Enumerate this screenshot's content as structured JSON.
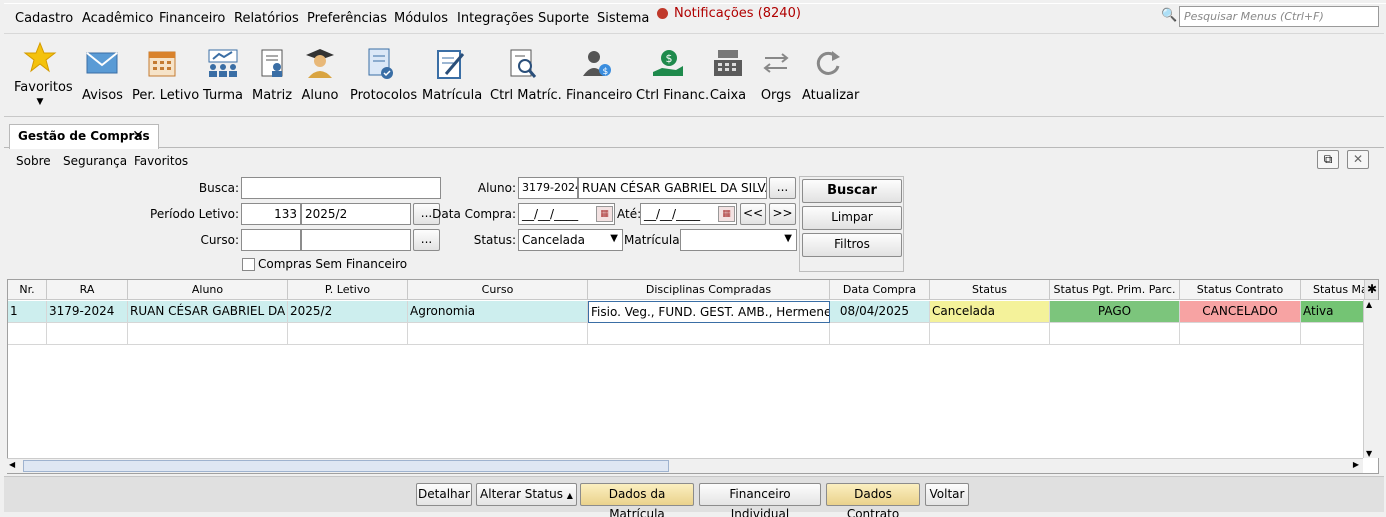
{
  "menu": {
    "items": [
      "Cadastro",
      "Acadêmico",
      "Financeiro",
      "Relatórios",
      "Preferências",
      "Módulos",
      "Integrações",
      "Suporte",
      "Sistema"
    ],
    "notifications": "Notificações (8240)",
    "search_placeholder": "Pesquisar Menus (Ctrl+F)"
  },
  "toolbar": {
    "favoritos": "Favoritos",
    "avisos": "Avisos",
    "per_letivo": "Per. Letivo",
    "turma": "Turma",
    "matriz": "Matriz",
    "aluno": "Aluno",
    "protocolos": "Protocolos",
    "matricula": "Matrícula",
    "ctrl_matric": "Ctrl Matríc.",
    "financeiro": "Financeiro",
    "ctrl_financ": "Ctrl Financ.",
    "caixa": "Caixa",
    "orgs": "Orgs",
    "atualizar": "Atualizar"
  },
  "tab": {
    "title": "Gestão de Compras",
    "close": "✕"
  },
  "submenu": {
    "sobre": "Sobre",
    "seguranca": "Segurança",
    "favoritos": "Favoritos"
  },
  "form": {
    "busca_label": "Busca:",
    "busca_value": "",
    "periodo_label": "Período Letivo:",
    "periodo_code": "133",
    "periodo_value": "2025/2",
    "curso_label": "Curso:",
    "curso_code": "",
    "curso_value": "",
    "aluno_label": "Aluno:",
    "aluno_ra": "3179-2024",
    "aluno_nome": "RUAN CÉSAR GABRIEL DA SILVA",
    "data_compra_label": "Data Compra:",
    "data_compra_value": "__/__/____",
    "ate_label": "Até:",
    "ate_value": "__/__/____",
    "status_label": "Status:",
    "status_value": "Cancelada",
    "matricula_label": "Matrícula:",
    "matricula_value": "",
    "sem_financeiro_label": "Compras Sem Financeiro",
    "ellipsis": "...",
    "prev": "<<",
    "next": ">>"
  },
  "buttons": {
    "buscar": "Buscar",
    "limpar": "Limpar",
    "filtros": "Filtros"
  },
  "grid": {
    "headers": [
      "Nr.",
      "RA",
      "Aluno",
      "P. Letivo",
      "Curso",
      "Disciplinas Compradas",
      "Data Compra",
      "Status",
      "Status Pgt. Prim. Parc.",
      "Status Contrato",
      "Status Ma"
    ],
    "rows": [
      [
        "1",
        "3179-2024",
        "RUAN CÉSAR GABRIEL DA S...",
        "2025/2",
        "Agronomia",
        "Fisio. Veg., FUND. GEST.  AMB., Hermeneuti...",
        "08/04/2025",
        "Cancelada",
        "PAGO",
        "CANCELADO",
        "Ativa"
      ]
    ]
  },
  "bottom": {
    "detalhar": "Detalhar",
    "alterar_status": "Alterar Status",
    "dados_matricula": "Dados da Matrícula",
    "financeiro_individual": "Financeiro Individual",
    "dados_contrato": "Dados Contrato",
    "voltar": "Voltar"
  },
  "colors": {
    "row_highlight": "#cdeeee",
    "status_yellow": "#f4f29a",
    "status_green": "#7cc57c",
    "status_red": "#f7a3a3",
    "ativa_green": "#74c474",
    "notification_red": "#b00000"
  }
}
